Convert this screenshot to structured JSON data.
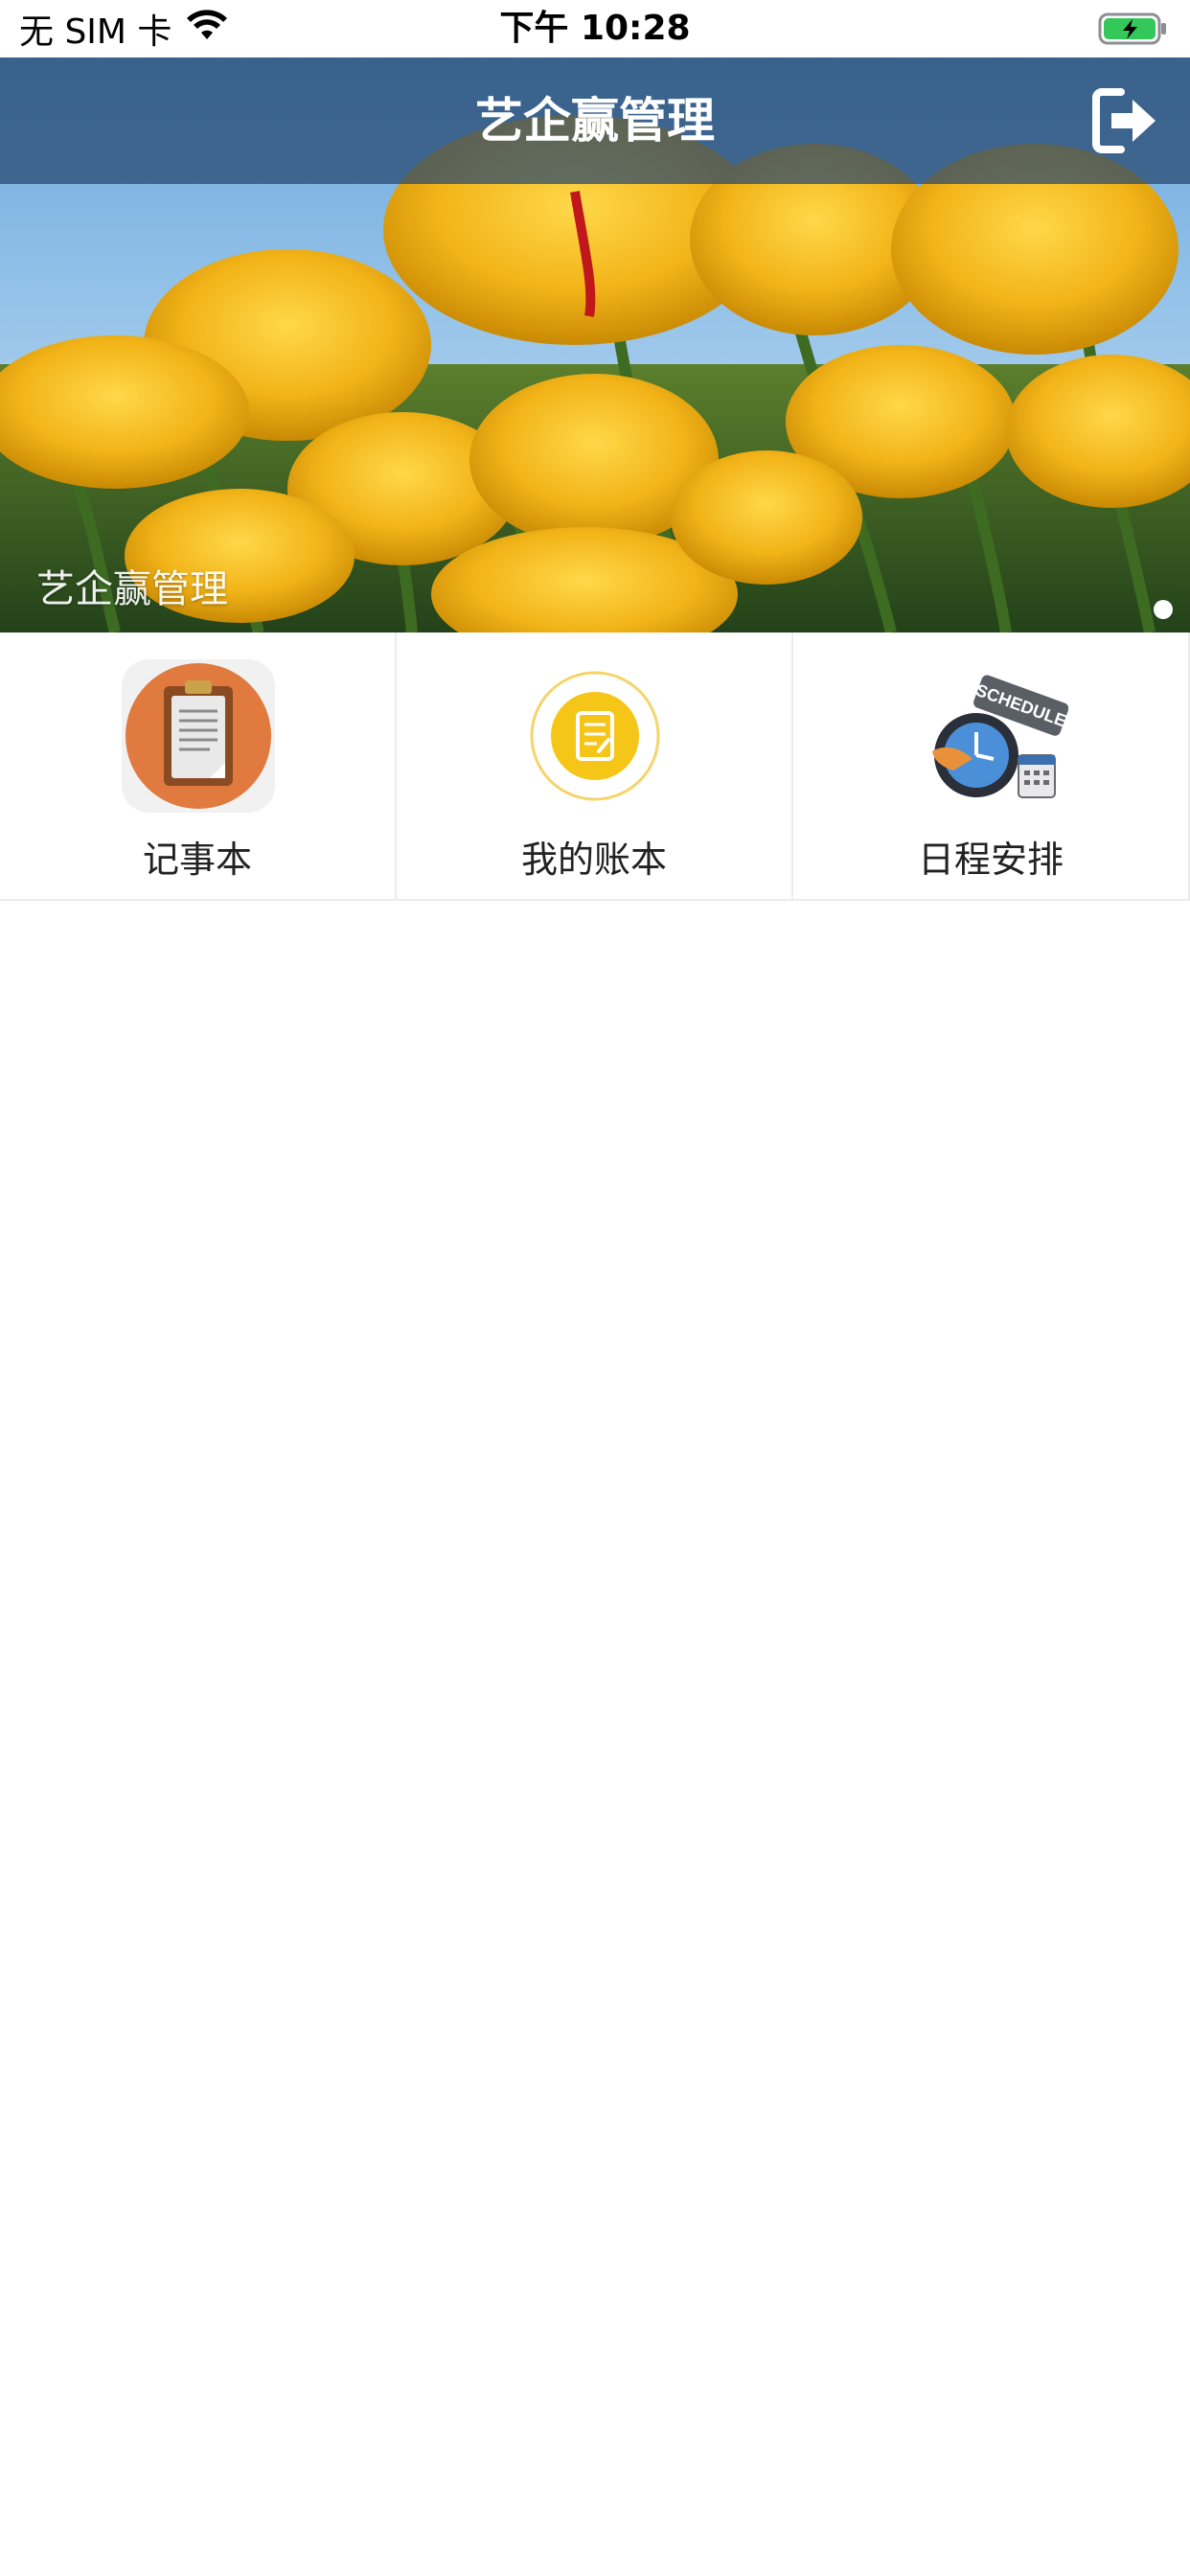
{
  "status_bar": {
    "carrier": "无 SIM 卡",
    "time": "下午 10:28",
    "icons": [
      "wifi-icon",
      "battery-charging-icon"
    ],
    "battery_color": "#34c759"
  },
  "nav_bar": {
    "title": "艺企赢管理",
    "background": "#26466e",
    "right_icon": "logout-icon"
  },
  "banner": {
    "caption": "艺企赢管理",
    "image": "yellow-tulips-photo",
    "page_count": 1
  },
  "grid": {
    "items": [
      {
        "label": "记事本",
        "icon": "notepad-clipboard-icon",
        "color": "#e07a3f"
      },
      {
        "label": "我的账本",
        "icon": "ledger-icon",
        "color": "#f5c518"
      },
      {
        "label": "日程安排",
        "icon": "schedule-clock-icon",
        "color": "#3a6fb0"
      }
    ]
  }
}
